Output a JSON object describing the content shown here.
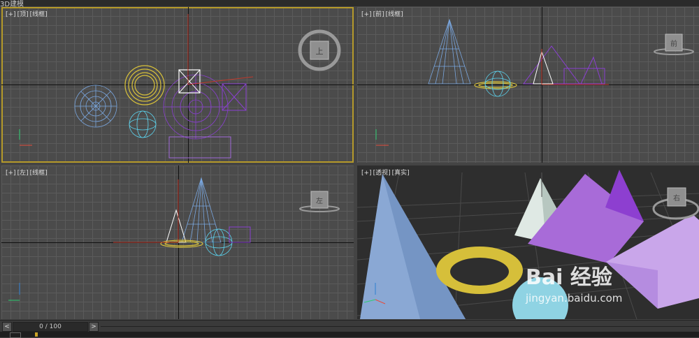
{
  "app": {
    "title": "3D建模"
  },
  "viewports": {
    "top": {
      "plus": "[+]",
      "name": "[顶]",
      "mode": "[线框]",
      "cube_label": "上"
    },
    "front": {
      "plus": "[+]",
      "name": "[前]",
      "mode": "[线框]",
      "cube_label": "前"
    },
    "left": {
      "plus": "[+]",
      "name": "[左]",
      "mode": "[线框]",
      "cube_label": "左"
    },
    "persp": {
      "plus": "[+]",
      "name": "[透视]",
      "mode": "[真实]",
      "cube_label": "右"
    }
  },
  "timeline": {
    "prev_label": "<",
    "next_label": ">",
    "frame_text": "0 / 100"
  },
  "watermark": {
    "brand": "Bai 经验",
    "url": "jingyan.baidu.com"
  },
  "colors": {
    "active_border": "#b59a2a",
    "cone_blue": "#7aa7e0",
    "torus_yellow": "#d9c23a",
    "sphere_cyan": "#5bd3ee",
    "purple": "#9b59d6",
    "pyramid_white": "#e6efe9"
  }
}
